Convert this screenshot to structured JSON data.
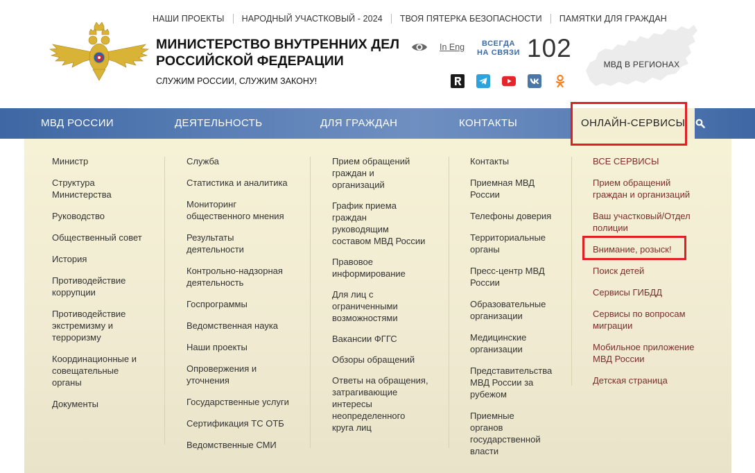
{
  "top_links": [
    {
      "label": "НАШИ ПРОЕКТЫ"
    },
    {
      "label": "НАРОДНЫЙ УЧАСТКОВЫЙ - 2024"
    },
    {
      "label": "ТВОЯ ПЯТЕРКА БЕЗОПАСНОСТИ"
    },
    {
      "label": "ПАМЯТКИ ДЛЯ ГРАЖДАН"
    }
  ],
  "site": {
    "title_line1": "МИНИСТЕРСТВО ВНУТРЕННИХ ДЕЛ",
    "title_line2": "РОССИЙСКОЙ ФЕДЕРАЦИИ",
    "motto": "СЛУЖИМ РОССИИ, СЛУЖИМ ЗАКОНУ!"
  },
  "header_tools": {
    "lang": "In Eng",
    "always_line1": "ВСЕГДА",
    "always_line2": "НА СВЯЗИ",
    "phone": "102",
    "regions": "МВД В РЕГИОНАХ"
  },
  "social": [
    {
      "icon": "rutube-icon",
      "color": "#1a1a1a"
    },
    {
      "icon": "telegram-icon",
      "color": "#2aa3de"
    },
    {
      "icon": "youtube-icon",
      "color": "#e5252a"
    },
    {
      "icon": "vk-icon",
      "color": "#4a76a8"
    },
    {
      "icon": "odnoklassniki-icon",
      "color": "#f58220"
    }
  ],
  "nav": [
    {
      "label": "МВД РОССИИ"
    },
    {
      "label": "ДЕЯТЕЛЬНОСТЬ"
    },
    {
      "label": "ДЛЯ ГРАЖДАН"
    },
    {
      "label": "КОНТАКТЫ"
    },
    {
      "label": "ОНЛАЙН-СЕРВИСЫ",
      "active": true
    }
  ],
  "dropdown": {
    "col1": [
      {
        "line1": "Министр"
      },
      {
        "line1": "Структура",
        "line2": "Министерства"
      },
      {
        "line1": "Руководство"
      },
      {
        "line1": "Общественный совет"
      },
      {
        "line1": "История"
      },
      {
        "line1": "Противодействие",
        "line2": "коррупции"
      },
      {
        "line1": "Противодействие",
        "line2": "экстремизму и",
        "line3": "терроризму"
      },
      {
        "line1": "Координационные и",
        "line2": "совещательные",
        "line3": "органы"
      },
      {
        "line1": "Документы"
      }
    ],
    "col2": [
      {
        "line1": "Служба"
      },
      {
        "line1": "Статистика и аналитика"
      },
      {
        "line1": "Мониторинг",
        "line2": "общественного мнения"
      },
      {
        "line1": "Результаты",
        "line2": "деятельности"
      },
      {
        "line1": "Контрольно-надзорная",
        "line2": "деятельность"
      },
      {
        "line1": "Госпрограммы"
      },
      {
        "line1": "Ведомственная наука"
      },
      {
        "line1": "Наши проекты"
      },
      {
        "line1": "Опровержения и",
        "line2": "уточнения"
      },
      {
        "line1": "Государственные услуги"
      },
      {
        "line1": "Сертификация ТС ОТБ"
      },
      {
        "line1": "Ведомственные СМИ"
      }
    ],
    "col3": [
      {
        "line1": "Прием обращений",
        "line2": "граждан и",
        "line3": "организаций"
      },
      {
        "line1": "График приема",
        "line2": "граждан",
        "line3": "руководящим",
        "line4": "составом МВД России"
      },
      {
        "line1": "Правовое",
        "line2": "информирование"
      },
      {
        "line1": "Для лиц с",
        "line2": "ограниченными",
        "line3": "возможностями"
      },
      {
        "line1": "Вакансии ФГГС"
      },
      {
        "line1": "Обзоры обращений"
      },
      {
        "line1": "Ответы на обращения,",
        "line2": "затрагивающие",
        "line3": "интересы",
        "line4": "неопределенного",
        "line5": "круга лиц"
      }
    ],
    "col4": [
      {
        "line1": "Контакты"
      },
      {
        "line1": "Приемная МВД",
        "line2": "России"
      },
      {
        "line1": "Телефоны доверия"
      },
      {
        "line1": "Территориальные",
        "line2": "органы"
      },
      {
        "line1": "Пресс-центр МВД",
        "line2": "России"
      },
      {
        "line1": "Образовательные",
        "line2": "организации"
      },
      {
        "line1": "Медицинские",
        "line2": "организации"
      },
      {
        "line1": "Представительства",
        "line2": "МВД России за",
        "line3": "рубежом"
      },
      {
        "line1": "Приемные",
        "line2": "органов",
        "line3": "государственной",
        "line4": "власти"
      }
    ],
    "col5": [
      {
        "line1": "ВСЕ СЕРВИСЫ"
      },
      {
        "line1": "Прием обращений",
        "line2": "граждан и организаций"
      },
      {
        "line1": "Ваш участковый/Отдел",
        "line2": "полиции"
      },
      {
        "line1": "Внимание, розыск!"
      },
      {
        "line1": "Поиск детей"
      },
      {
        "line1": "Сервисы ГИБДД"
      },
      {
        "line1": "Сервисы по вопросам",
        "line2": "миграции"
      },
      {
        "line1": "Мобильное приложение",
        "line2": "МВД России"
      },
      {
        "line1": "Детская страница"
      }
    ]
  }
}
